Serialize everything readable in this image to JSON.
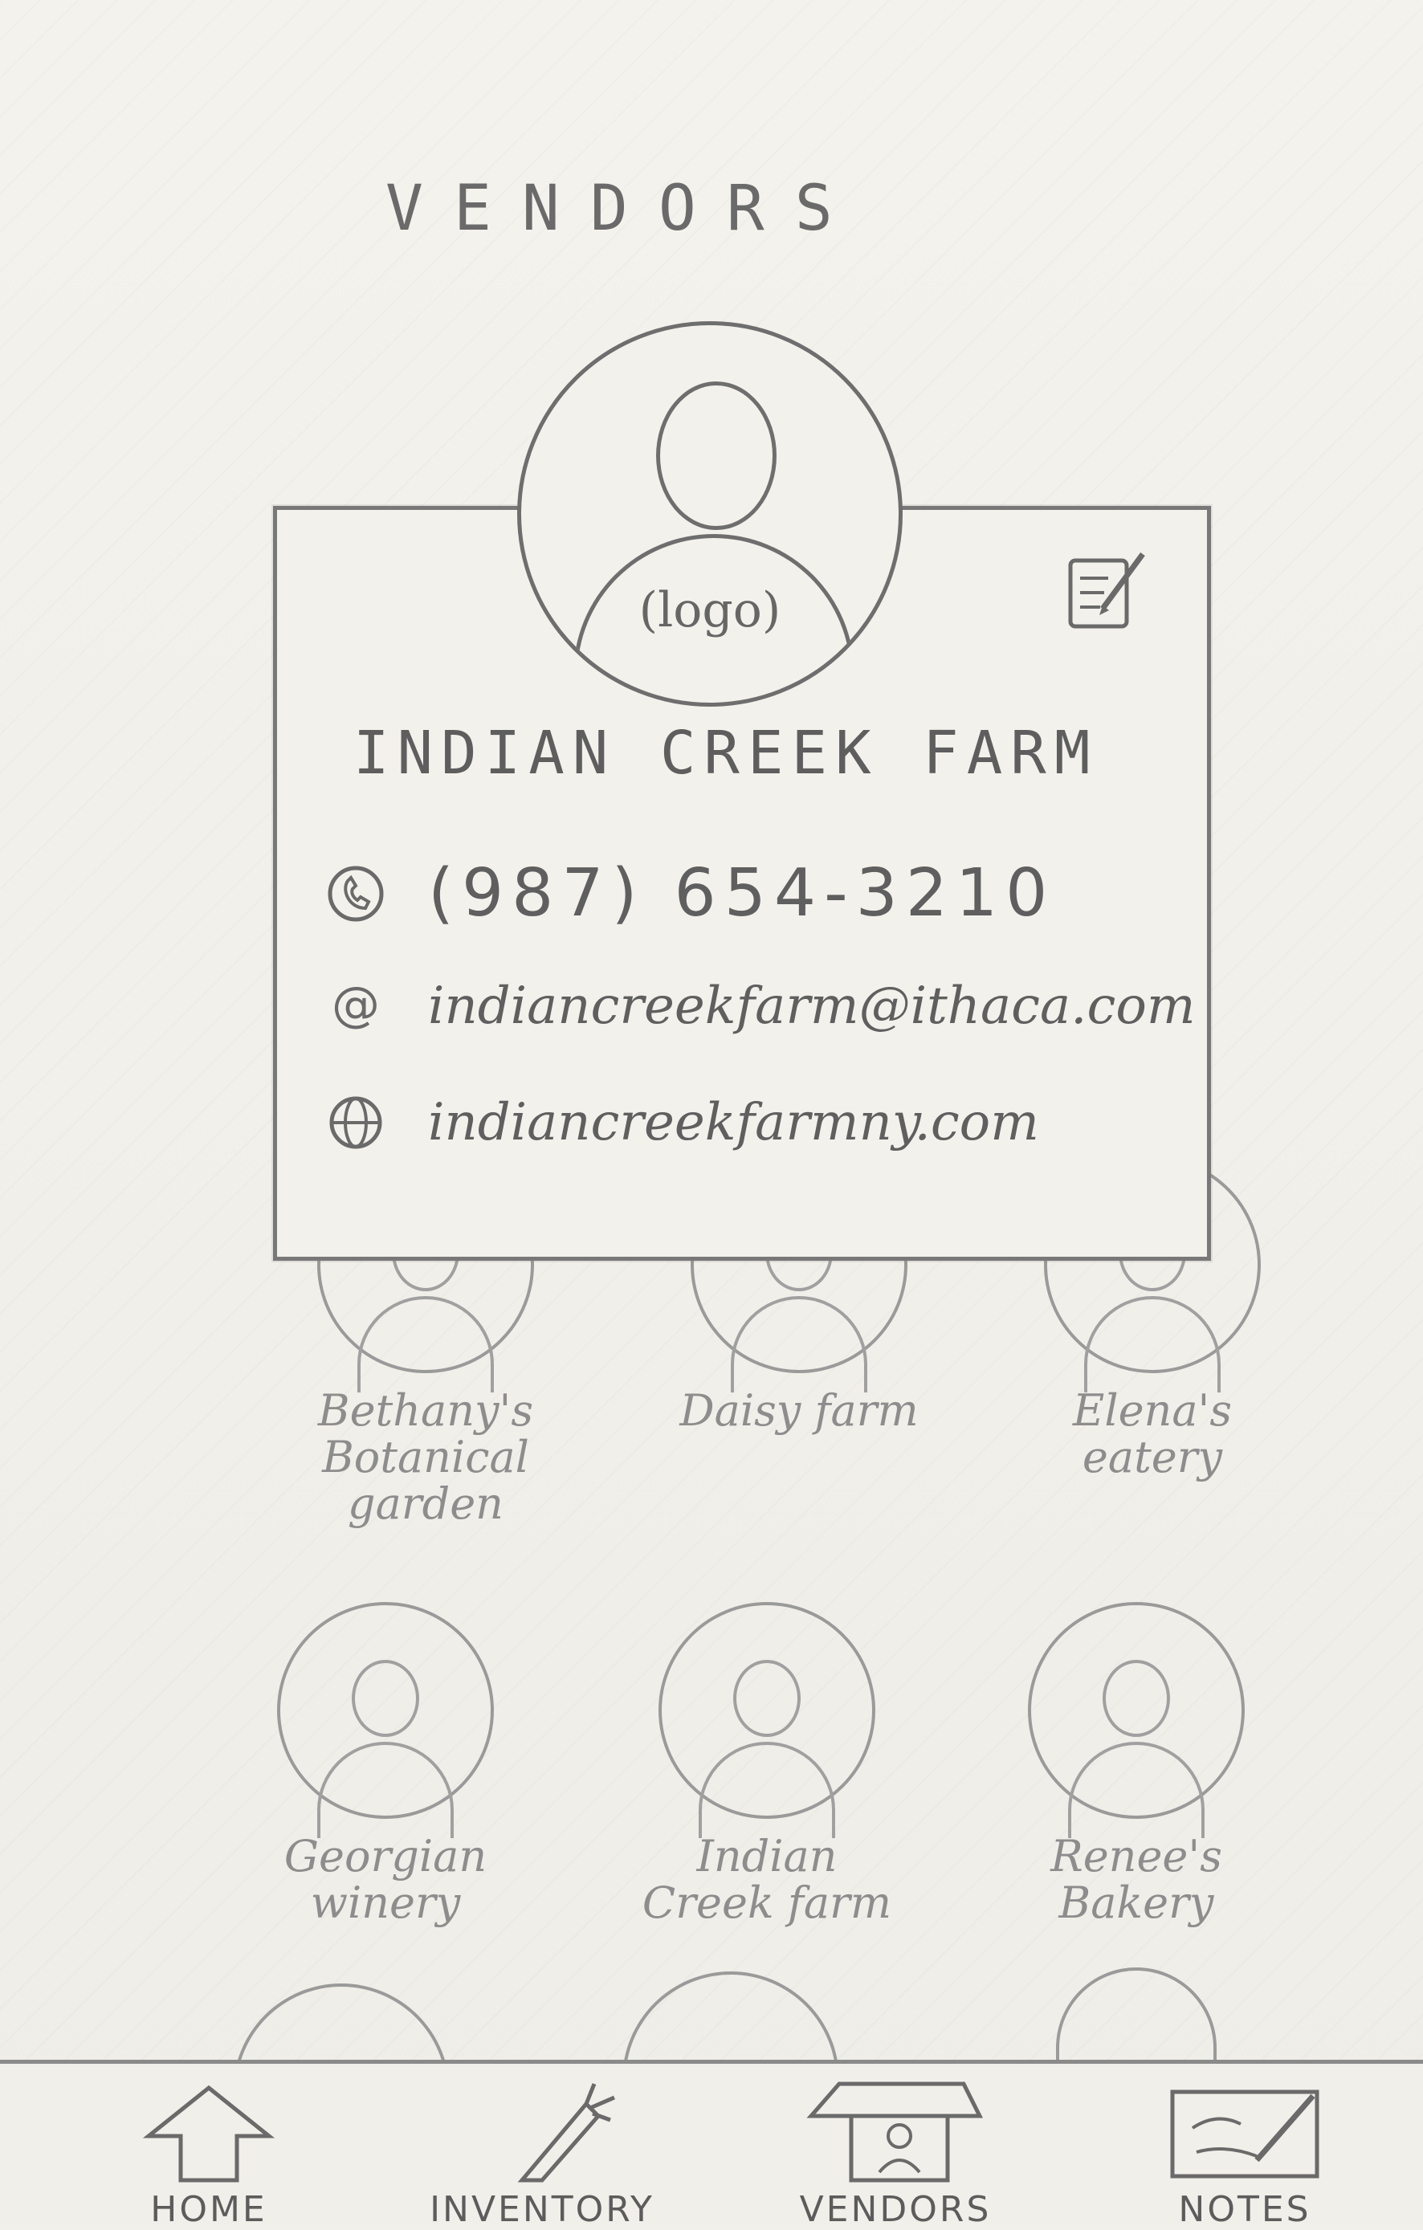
{
  "header": {
    "title": "VENDORS"
  },
  "detail_card": {
    "logo_label": "(logo)",
    "name": "INDIAN CREEK FARM",
    "phone": "(987) 654-3210",
    "email": "indiancreekfarm@ithaca.com",
    "website": "indiancreekfarmny.com"
  },
  "vendors": [
    {
      "name": "Bethany's Botanical garden"
    },
    {
      "name": "Daisy farm"
    },
    {
      "name": "Elena's eatery"
    },
    {
      "name": "Georgian winery"
    },
    {
      "name": "Indian Creek farm"
    },
    {
      "name": "Renee's Bakery"
    }
  ],
  "nav": {
    "items": [
      {
        "label": "HOME",
        "icon": "home-icon"
      },
      {
        "label": "INVENTORY",
        "icon": "carrot-icon"
      },
      {
        "label": "VENDORS",
        "icon": "vendor-stall-icon"
      },
      {
        "label": "NOTES",
        "icon": "notes-icon"
      }
    ]
  }
}
